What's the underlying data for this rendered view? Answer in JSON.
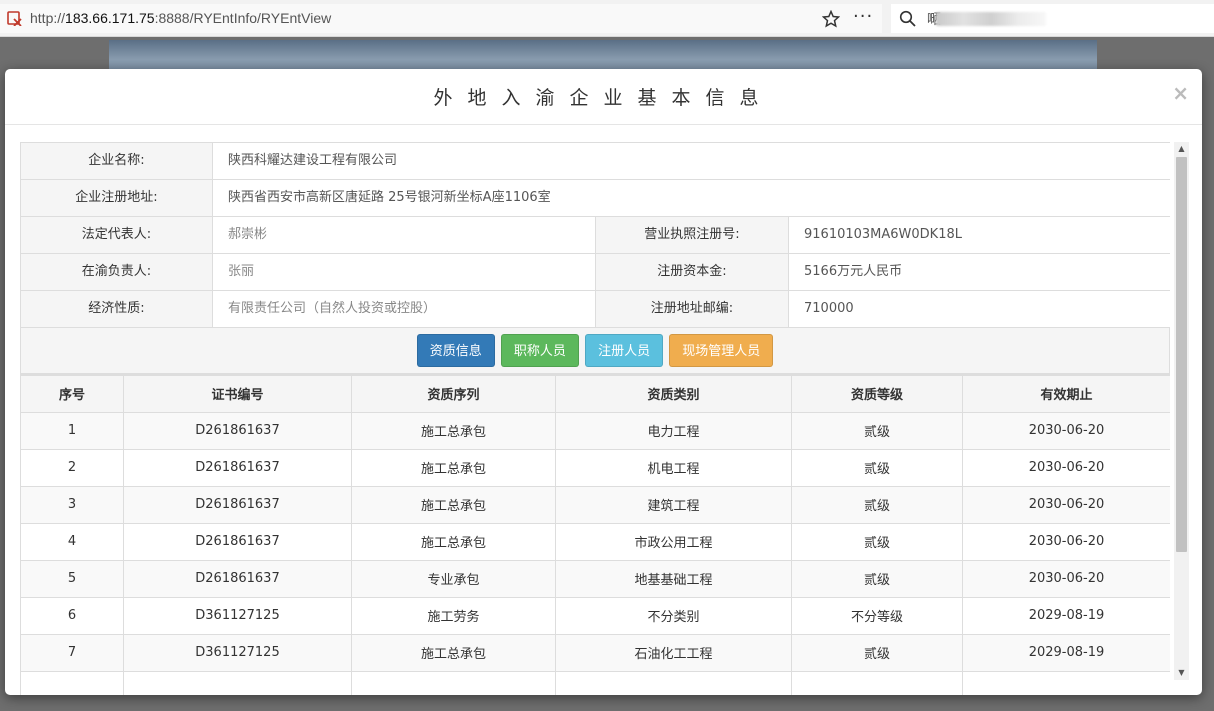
{
  "browser": {
    "url_prefix": "http://",
    "url_host": "183.66.171.75",
    "url_rest": ":8888/RYEntInfo/RYEntView",
    "search_prefix": "嗮"
  },
  "modal": {
    "title": "外地入渝企业基本信息",
    "close_label": "×"
  },
  "info": {
    "company_name_label": "企业名称:",
    "company_name": "陕西科耀达建设工程有限公司",
    "address_label": "企业注册地址:",
    "address": "陕西省西安市高新区唐延路 25号银河新坐标A座1106室",
    "legal_rep_label": "法定代表人:",
    "legal_rep": "郝崇彬",
    "license_label": "营业执照注册号:",
    "license": "91610103MA6W0DK18L",
    "manager_label": "在渝负责人:",
    "manager": "张丽",
    "capital_label": "注册资本金:",
    "capital": "5166万元人民币",
    "nature_label": "经济性质:",
    "nature": "有限责任公司（自然人投资或控股）",
    "postcode_label": "注册地址邮编:",
    "postcode": "710000"
  },
  "tabs": {
    "qualification": "资质信息",
    "titled_staff": "职称人员",
    "registered_staff": "注册人员",
    "site_managers": "现场管理人员"
  },
  "table": {
    "headers": [
      "序号",
      "证书编号",
      "资质序列",
      "资质类别",
      "资质等级",
      "有效期止"
    ],
    "rows": [
      [
        "1",
        "D261861637",
        "施工总承包",
        "电力工程",
        "贰级",
        "2030-06-20"
      ],
      [
        "2",
        "D261861637",
        "施工总承包",
        "机电工程",
        "贰级",
        "2030-06-20"
      ],
      [
        "3",
        "D261861637",
        "施工总承包",
        "建筑工程",
        "贰级",
        "2030-06-20"
      ],
      [
        "4",
        "D261861637",
        "施工总承包",
        "市政公用工程",
        "贰级",
        "2030-06-20"
      ],
      [
        "5",
        "D261861637",
        "专业承包",
        "地基基础工程",
        "贰级",
        "2030-06-20"
      ],
      [
        "6",
        "D361127125",
        "施工劳务",
        "不分类别",
        "不分等级",
        "2029-08-19"
      ],
      [
        "7",
        "D361127125",
        "施工总承包",
        "石油化工工程",
        "贰级",
        "2029-08-19"
      ],
      [
        "",
        "",
        "",
        "",
        "",
        ""
      ]
    ]
  }
}
